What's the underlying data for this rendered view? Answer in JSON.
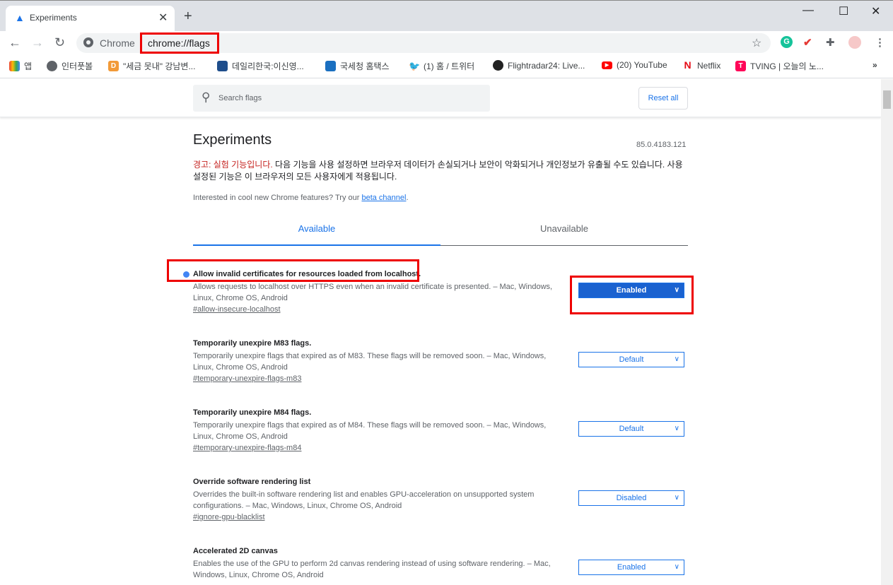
{
  "tab": {
    "title": "Experiments"
  },
  "omnibox": {
    "scheme_label": "Chrome",
    "url": "chrome://flags"
  },
  "bookmarks": [
    {
      "label": "앱",
      "icon": "apps-grid-icon"
    },
    {
      "label": "인터풋볼",
      "icon": "globe-icon"
    },
    {
      "label": "\"세금 못내\" 강남변...",
      "icon": "d-icon"
    },
    {
      "label": "데일리한국:이신영...",
      "icon": "dailyhankook-icon"
    },
    {
      "label": "국세청 홈택스",
      "icon": "hometax-icon"
    },
    {
      "label": "(1) 홈 / 트위터",
      "icon": "twitter-icon"
    },
    {
      "label": "Flightradar24: Live...",
      "icon": "flightradar-icon"
    },
    {
      "label": "(20) YouTube",
      "icon": "youtube-icon"
    },
    {
      "label": "Netflix",
      "icon": "netflix-icon"
    },
    {
      "label": "TVING | 오늘의 노...",
      "icon": "tving-icon"
    }
  ],
  "search": {
    "placeholder": "Search flags"
  },
  "reset_label": "Reset all",
  "page": {
    "title": "Experiments",
    "version": "85.0.4183.121",
    "warning_red": "경고: 실험 기능입니다.",
    "warning_rest": " 다음 기능을 사용 설정하면 브라우저 데이터가 손실되거나 보안이 악화되거나 개인정보가 유출될 수도 있습니다. 사용 설정된 기능은 이 브라우저의 모든 사용자에게 적용됩니다.",
    "interest_text": "Interested in cool new Chrome features? Try our ",
    "interest_link": "beta channel",
    "interest_end": "."
  },
  "tabs": {
    "available": "Available",
    "unavailable": "Unavailable"
  },
  "flags": [
    {
      "title": "Allow invalid certificates for resources loaded from localhost.",
      "desc": "Allows requests to localhost over HTTPS even when an invalid certificate is presented. – Mac, Windows, Linux, Chrome OS, Android",
      "link": "#allow-insecure-localhost",
      "value": "Enabled"
    },
    {
      "title": "Temporarily unexpire M83 flags.",
      "desc": "Temporarily unexpire flags that expired as of M83. These flags will be removed soon. – Mac, Windows, Linux, Chrome OS, Android",
      "link": "#temporary-unexpire-flags-m83",
      "value": "Default"
    },
    {
      "title": "Temporarily unexpire M84 flags.",
      "desc": "Temporarily unexpire flags that expired as of M84. These flags will be removed soon. – Mac, Windows, Linux, Chrome OS, Android",
      "link": "#temporary-unexpire-flags-m84",
      "value": "Default"
    },
    {
      "title": "Override software rendering list",
      "desc": "Overrides the built-in software rendering list and enables GPU-acceleration on unsupported system configurations. – Mac, Windows, Linux, Chrome OS, Android",
      "link": "#ignore-gpu-blacklist",
      "value": "Disabled"
    },
    {
      "title": "Accelerated 2D canvas",
      "desc": "Enables the use of the GPU to perform 2d canvas rendering instead of using software rendering. – Mac, Windows, Linux, Chrome OS, Android",
      "link": "",
      "value": "Enabled"
    }
  ],
  "colors": {
    "accent": "#1a73e8",
    "highlight": "#ee0000",
    "warning": "#c5221f"
  }
}
